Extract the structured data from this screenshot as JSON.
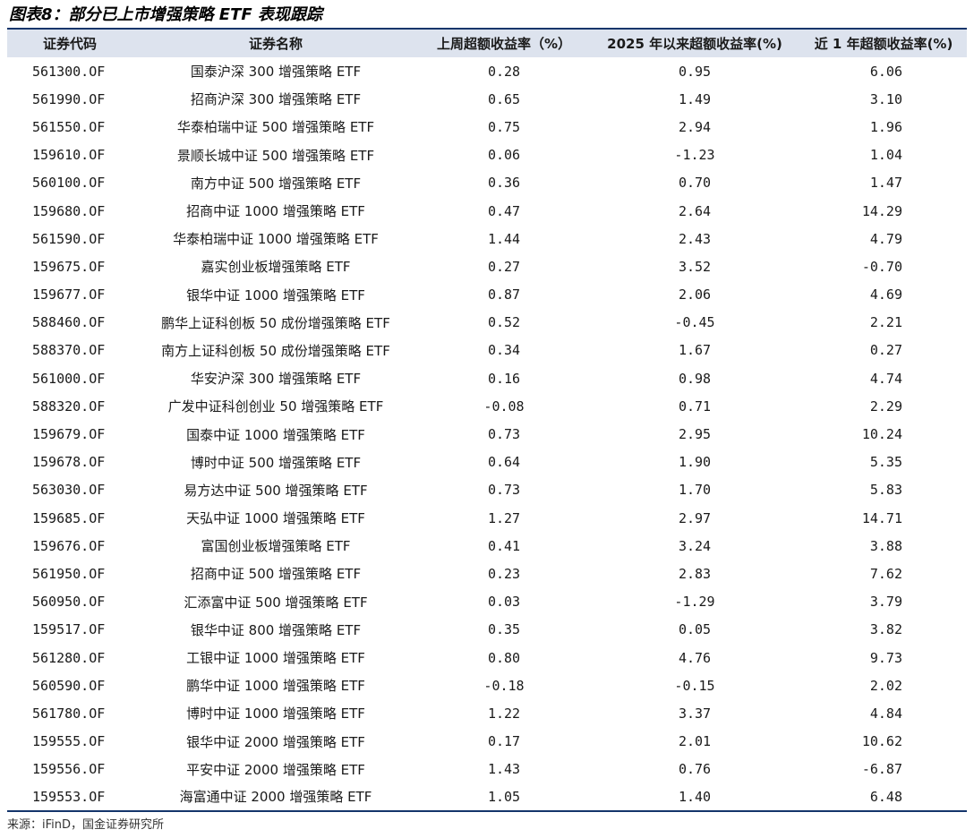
{
  "title": "图表8：部分已上市增强策略 ETF 表现跟踪",
  "source": "来源：iFinD，国金证券研究所",
  "table": {
    "headers": [
      "证券代码",
      "证券名称",
      "上周超额收益率（%）",
      "2025 年以来超额收益率(%)",
      "近 1 年超额收益率(%)"
    ],
    "rows": [
      [
        "561300.OF",
        "国泰沪深 300 增强策略 ETF",
        "0.28",
        "0.95",
        "6.06"
      ],
      [
        "561990.OF",
        "招商沪深 300 增强策略 ETF",
        "0.65",
        "1.49",
        "3.10"
      ],
      [
        "561550.OF",
        "华泰柏瑞中证 500 增强策略 ETF",
        "0.75",
        "2.94",
        "1.96"
      ],
      [
        "159610.OF",
        "景顺长城中证 500 增强策略 ETF",
        "0.06",
        "-1.23",
        "1.04"
      ],
      [
        "560100.OF",
        "南方中证 500 增强策略 ETF",
        "0.36",
        "0.70",
        "1.47"
      ],
      [
        "159680.OF",
        "招商中证 1000 增强策略 ETF",
        "0.47",
        "2.64",
        "14.29"
      ],
      [
        "561590.OF",
        "华泰柏瑞中证 1000 增强策略 ETF",
        "1.44",
        "2.43",
        "4.79"
      ],
      [
        "159675.OF",
        "嘉实创业板增强策略 ETF",
        "0.27",
        "3.52",
        "-0.70"
      ],
      [
        "159677.OF",
        "银华中证 1000 增强策略 ETF",
        "0.87",
        "2.06",
        "4.69"
      ],
      [
        "588460.OF",
        "鹏华上证科创板 50 成份增强策略 ETF",
        "0.52",
        "-0.45",
        "2.21"
      ],
      [
        "588370.OF",
        "南方上证科创板 50 成份增强策略 ETF",
        "0.34",
        "1.67",
        "0.27"
      ],
      [
        "561000.OF",
        "华安沪深 300 增强策略 ETF",
        "0.16",
        "0.98",
        "4.74"
      ],
      [
        "588320.OF",
        "广发中证科创创业 50 增强策略 ETF",
        "-0.08",
        "0.71",
        "2.29"
      ],
      [
        "159679.OF",
        "国泰中证 1000 增强策略 ETF",
        "0.73",
        "2.95",
        "10.24"
      ],
      [
        "159678.OF",
        "博时中证 500 增强策略 ETF",
        "0.64",
        "1.90",
        "5.35"
      ],
      [
        "563030.OF",
        "易方达中证 500 增强策略 ETF",
        "0.73",
        "1.70",
        "5.83"
      ],
      [
        "159685.OF",
        "天弘中证 1000 增强策略 ETF",
        "1.27",
        "2.97",
        "14.71"
      ],
      [
        "159676.OF",
        "富国创业板增强策略 ETF",
        "0.41",
        "3.24",
        "3.88"
      ],
      [
        "561950.OF",
        "招商中证 500 增强策略 ETF",
        "0.23",
        "2.83",
        "7.62"
      ],
      [
        "560950.OF",
        "汇添富中证 500 增强策略 ETF",
        "0.03",
        "-1.29",
        "3.79"
      ],
      [
        "159517.OF",
        "银华中证 800 增强策略 ETF",
        "0.35",
        "0.05",
        "3.82"
      ],
      [
        "561280.OF",
        "工银中证 1000 增强策略 ETF",
        "0.80",
        "4.76",
        "9.73"
      ],
      [
        "560590.OF",
        "鹏华中证 1000 增强策略 ETF",
        "-0.18",
        "-0.15",
        "2.02"
      ],
      [
        "561780.OF",
        "博时中证 1000 增强策略 ETF",
        "1.22",
        "3.37",
        "4.84"
      ],
      [
        "159555.OF",
        "银华中证 2000 增强策略 ETF",
        "0.17",
        "2.01",
        "10.62"
      ],
      [
        "159556.OF",
        "平安中证 2000 增强策略 ETF",
        "1.43",
        "0.76",
        "-6.87"
      ],
      [
        "159553.OF",
        "海富通中证 2000 增强策略 ETF",
        "1.05",
        "1.40",
        "6.48"
      ]
    ]
  },
  "colors": {
    "header_bg": "#dde3ee",
    "rule": "#14356b",
    "text": "#1a1a1a"
  }
}
